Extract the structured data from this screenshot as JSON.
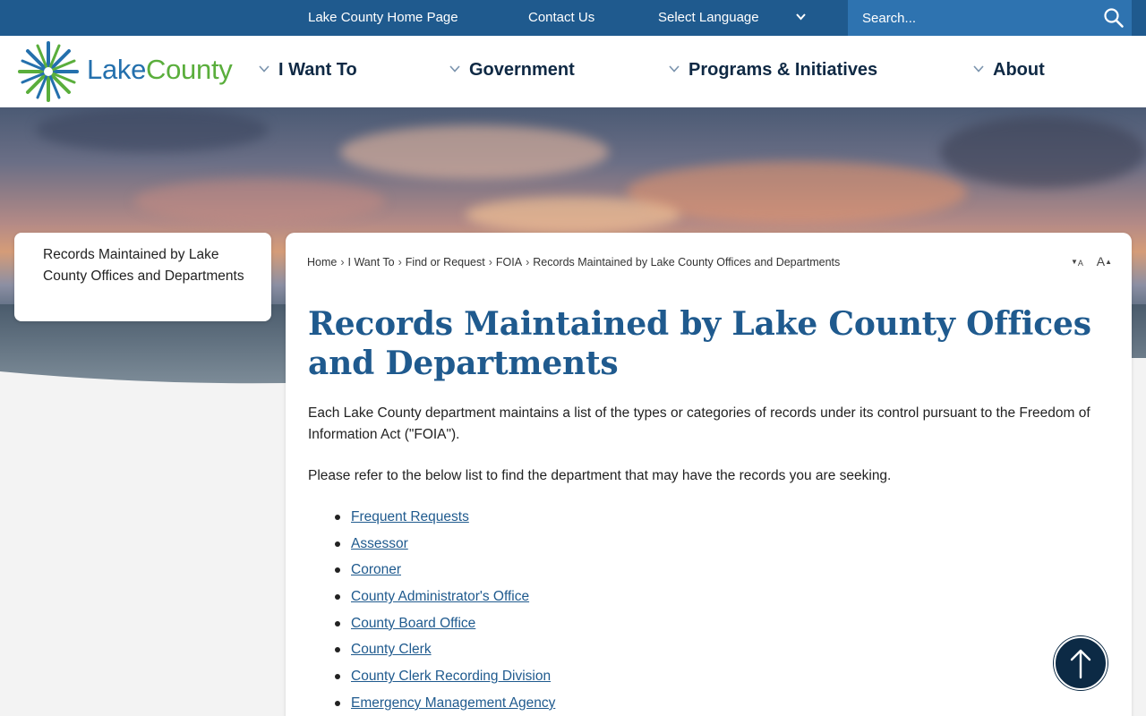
{
  "topbar": {
    "home_link": "Lake County Home Page",
    "contact_link": "Contact Us",
    "language_label": "Select Language",
    "search_placeholder": "Search..."
  },
  "logo": {
    "word1": "Lake",
    "word2": "County"
  },
  "nav": [
    {
      "label": "I Want To"
    },
    {
      "label": "Government"
    },
    {
      "label": "Programs & Initiatives"
    },
    {
      "label": "About"
    }
  ],
  "sidebar": {
    "current_page": "Records Maintained by Lake County Offices and Departments"
  },
  "breadcrumb": [
    "Home",
    "I Want To",
    "Find or Request",
    "FOIA",
    "Records Maintained by Lake County Offices and Departments"
  ],
  "font_controls": {
    "decrease": "A",
    "increase": "A"
  },
  "page": {
    "title": "Records Maintained by Lake County Offices and Departments",
    "intro": "Each Lake County department maintains a list of the types or categories of records under its control pursuant to the Freedom of Information Act (\"FOIA\").",
    "instruction": "Please refer to the below list to find the department that may have the records you are seeking.",
    "departments": [
      "Frequent Requests",
      "Assessor",
      "Coroner",
      "County Administrator's Office",
      "County Board Office",
      "County Clerk",
      "County Clerk Recording Division",
      "Emergency Management Agency"
    ]
  },
  "colors": {
    "brand_blue": "#1f5a8e",
    "brand_green": "#5aae3c",
    "dark_navy": "#0c2a45"
  },
  "icons": [
    "search-icon",
    "chevron-down-icon",
    "arrow-up-icon",
    "lake-county-logo-icon"
  ]
}
